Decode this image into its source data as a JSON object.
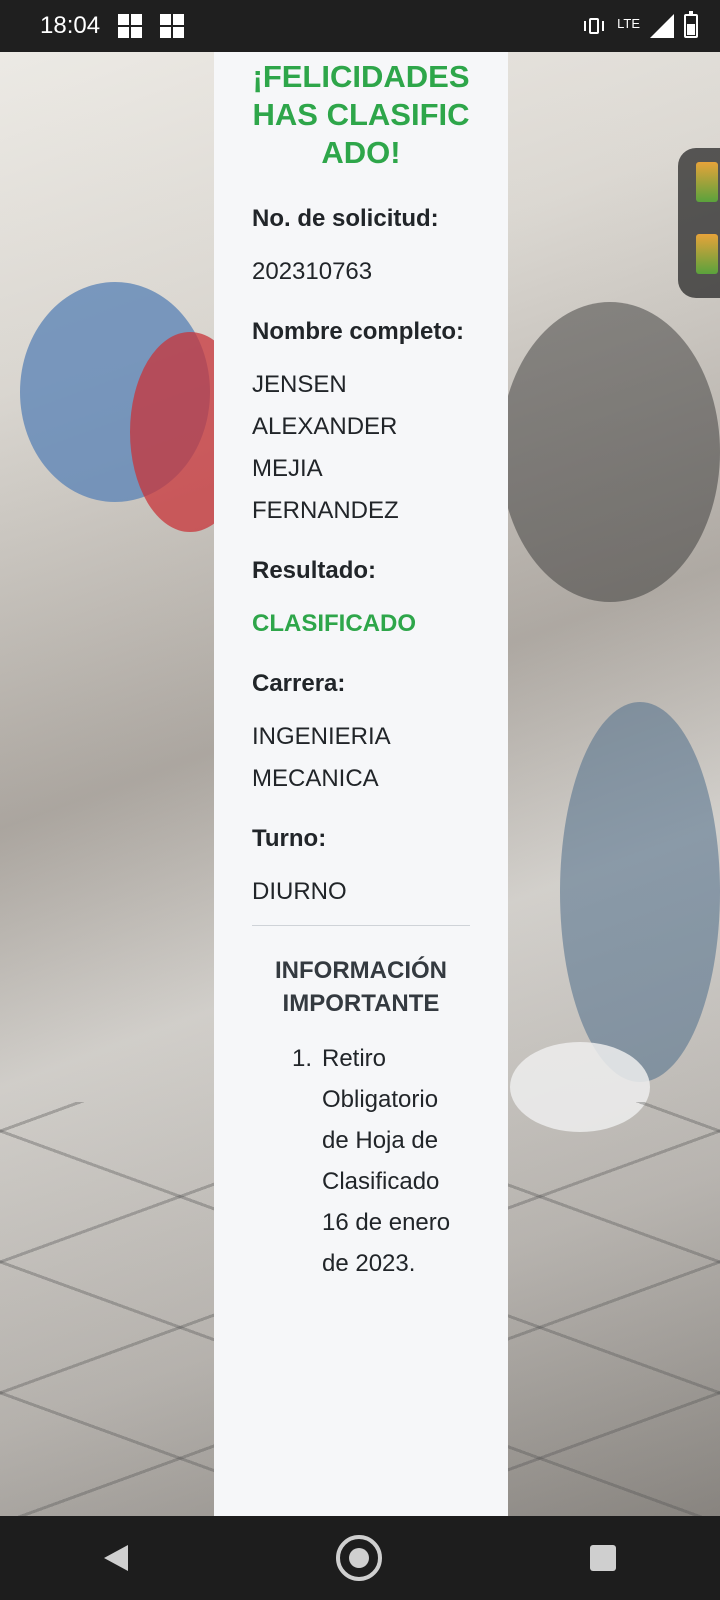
{
  "status_bar": {
    "time": "18:04",
    "network": "LTE",
    "icons": [
      "notification-icon",
      "notification-icon",
      "vibrate-icon",
      "signal-icon",
      "battery-icon"
    ]
  },
  "result_card": {
    "headline": "¡FELICIDADES HAS CLASIFICADO!",
    "fields": {
      "solicitud_label": "No. de solicitud:",
      "solicitud_value": "202310763",
      "nombre_label": "Nombre completo:",
      "nombre_value": "JENSEN ALEXANDER MEJIA FERNANDEZ",
      "resultado_label": "Resultado:",
      "resultado_value": "CLASIFICADO",
      "carrera_label": "Carrera:",
      "carrera_value": "INGENIERIA MECANICA",
      "turno_label": "Turno:",
      "turno_value": "DIURNO"
    },
    "info": {
      "title": "INFORMACIÓN IMPORTANTE",
      "items": [
        {
          "number": "1.",
          "text": "Retiro Obligatorio de Hoja de Clasificado 16 de enero de 2023."
        }
      ]
    },
    "colors": {
      "accent_green": "#2ea64a",
      "card_background": "#f6f7f9"
    }
  },
  "navigation_bar": {
    "buttons": [
      "back-icon",
      "home-icon",
      "recent-apps-icon"
    ]
  }
}
